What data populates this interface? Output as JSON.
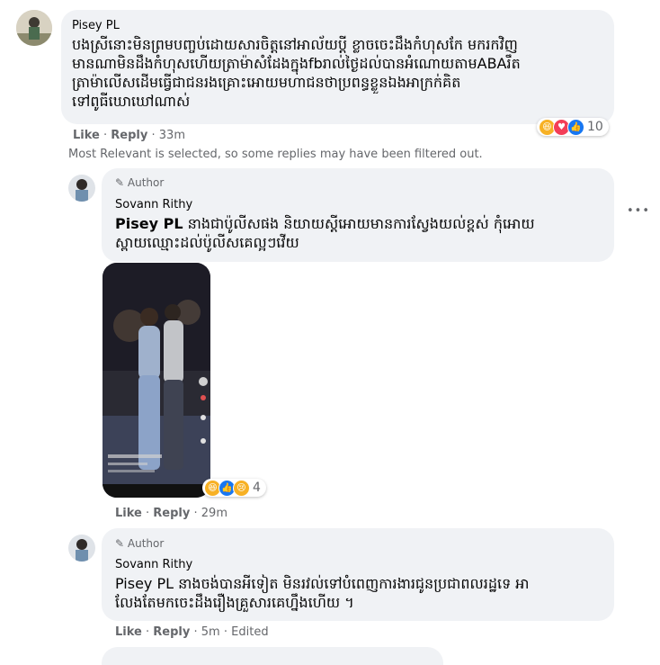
{
  "comment1": {
    "author": "Pisey PL",
    "text_lines": [
      "បងស្រីនោះមិនព្រមបញ្ចប់ដោយសារចិត្តនៅអាល័យប្តី ខ្លាចចេះដឹងកំហុសកែ មករកវិញ",
      "មានណាមិនដឹងកំហុសហើយត្រាម៉ាសំដែងក្នុងfbរាល់ថ្ងៃដល់បានអំណោយតាមABAរឹត",
      "ត្រាម៉ាលើសដើមធ្វើជាជនរងគ្រោះអោយមហាជនថាប្រពន្ធខ្លួនឯងអាក្រក់គិត",
      "ទៅពូធីឃោឃៅណាស់"
    ],
    "like": "Like",
    "reply": "Reply",
    "time": "33m",
    "reaction_count": "10",
    "reaction_icons": [
      "haha",
      "love",
      "like"
    ]
  },
  "notice": "Most Relevant is selected, so some replies may have been filtered out.",
  "reply1": {
    "badge": "Author",
    "author": "Sovann Rithy",
    "mention": "Pisey PL",
    "text_line1": " នាងជាប៉ូលីសផង និយាយស្តីអោយមានការស្វែងយល់ខ្ពស់ កុំអោយ",
    "text_line2": "ស្ពាយឈ្មោះដល់ប៉ូលីសគេល្អៗវើយ",
    "like": "Like",
    "reply": "Reply",
    "time": "29m",
    "reaction_count": "4",
    "reaction_icons": [
      "haha",
      "like",
      "sad"
    ]
  },
  "reply2": {
    "badge": "Author",
    "author": "Sovann Rithy",
    "mention": "Pisey PL",
    "text_line1": " នាងចង់បានអីទៀត មិនរវល់ទៅបំពេញការងារជូនប្រជាពលរដ្ឋទេ អា",
    "text_line2": "លែងតែមកចេះដឹងរឿងគ្រួសារគេហ្នឹងហើយ ។",
    "like": "Like",
    "reply": "Reply",
    "time": "5m",
    "edited": "Edited"
  },
  "more_options": "•••",
  "separator": "·",
  "colors": {
    "bubble": "#f0f2f5",
    "meta": "#65676b",
    "like_blue": "#1877f2",
    "love_red": "#f33e58",
    "haha_yellow": "#f7b125"
  }
}
